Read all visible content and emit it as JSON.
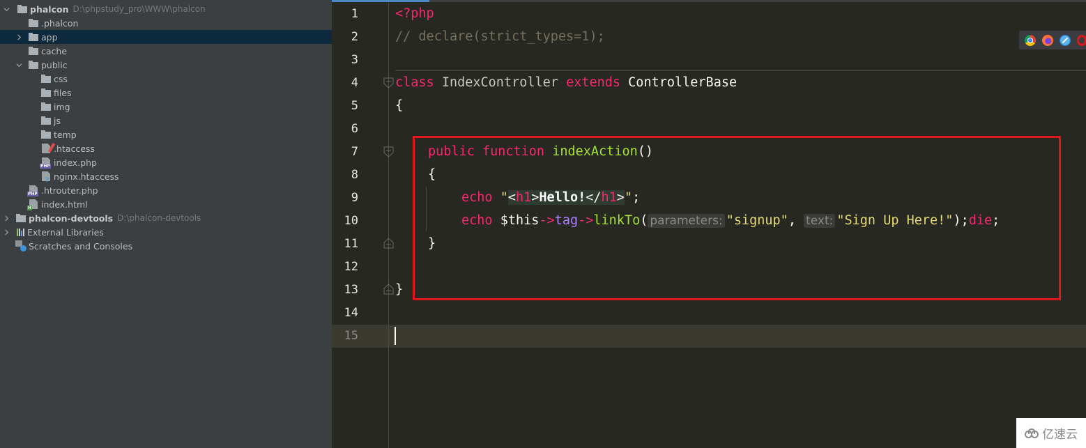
{
  "project_tree": {
    "items": [
      {
        "name": "phalcon",
        "path": "D:\\phpstudy_pro\\WWW\\phalcon",
        "type": "folder",
        "depth": 0,
        "expanded": true,
        "bold": true
      },
      {
        "name": ".phalcon",
        "type": "folder",
        "depth": 1
      },
      {
        "name": "app",
        "type": "folder",
        "depth": 1,
        "expanded": false,
        "selected": true
      },
      {
        "name": "cache",
        "type": "folder",
        "depth": 1
      },
      {
        "name": "public",
        "type": "folder",
        "depth": 1,
        "expanded": true
      },
      {
        "name": "css",
        "type": "folder",
        "depth": 2
      },
      {
        "name": "files",
        "type": "folder",
        "depth": 2
      },
      {
        "name": "img",
        "type": "folder",
        "depth": 2
      },
      {
        "name": "js",
        "type": "folder",
        "depth": 2
      },
      {
        "name": "temp",
        "type": "folder",
        "depth": 2
      },
      {
        "name": ".htaccess",
        "type": "htaccess-file",
        "depth": 2
      },
      {
        "name": "index.php",
        "type": "php-file",
        "depth": 2
      },
      {
        "name": "nginx.htaccess",
        "type": "unknown-file",
        "depth": 2
      },
      {
        "name": ".htrouter.php",
        "type": "php-file",
        "depth": 1
      },
      {
        "name": "index.html",
        "type": "html-file",
        "depth": 1
      },
      {
        "name": "phalcon-devtools",
        "path": "D:\\phalcon-devtools",
        "type": "folder",
        "depth": 0,
        "expanded": false,
        "bold": true
      },
      {
        "name": "External Libraries",
        "type": "libraries",
        "depth": 0,
        "expanded": false
      },
      {
        "name": "Scratches and Consoles",
        "type": "scratches",
        "depth": 0
      }
    ]
  },
  "editor": {
    "language": "php",
    "current_line": 15,
    "line_numbers": [
      "1",
      "2",
      "3",
      "4",
      "5",
      "6",
      "7",
      "8",
      "9",
      "10",
      "11",
      "12",
      "13",
      "14",
      "15"
    ],
    "lines": {
      "l1": {
        "open_tag": "<?php"
      },
      "l2": {
        "comment": "// declare(strict_types=1);"
      },
      "l4": {
        "kw_class": "class",
        "class_name": "IndexController",
        "kw_extends": "extends",
        "parent": "ControllerBase"
      },
      "l5": {
        "brace": "{"
      },
      "l7": {
        "kw_public": "public",
        "kw_function": "function",
        "fn_name": "indexAction",
        "parens": "()"
      },
      "l8": {
        "brace": "{"
      },
      "l9": {
        "kw_echo": "echo",
        "q1": "\"",
        "lt1": "<",
        "tag1": "h1",
        "gt1": ">",
        "text": "Hello!",
        "lt2": "</",
        "tag2": "h1",
        "gt2": ">",
        "q2": "\"",
        "semi": ";"
      },
      "l10": {
        "kw_echo": "echo",
        "var": "$this",
        "arrow1": "->",
        "prop": "tag",
        "arrow2": "->",
        "method": "linkTo",
        "open": "(",
        "hint1": "parameters:",
        "arg1": "\"signup\"",
        "comma": ", ",
        "hint2": "text:",
        "arg2": "\"Sign Up Here!\"",
        "close": ");",
        "kw_die": "die",
        "semi": ";"
      },
      "l11": {
        "brace": "}"
      },
      "l13": {
        "brace": "}"
      }
    }
  },
  "browser_toolbar": {
    "browsers": [
      "chrome",
      "firefox",
      "safari",
      "opera"
    ]
  },
  "annotation": {
    "highlight_color": "#e0161b"
  },
  "watermark": {
    "text": "亿速云"
  },
  "colors": {
    "keyword": "#f92672",
    "function": "#a6e22e",
    "string": "#e6db74",
    "comment": "#75715e",
    "property": "#ae81ff",
    "editor_bg": "#272822",
    "sidebar_bg": "#3c3f41",
    "selection_bg": "#0d293e"
  }
}
